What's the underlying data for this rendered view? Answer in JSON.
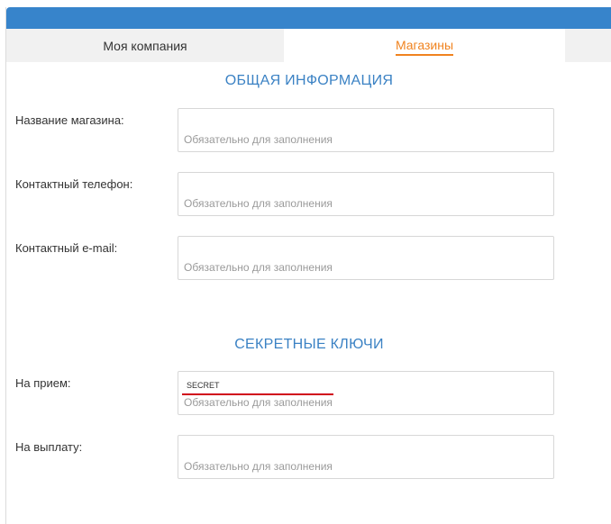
{
  "theme": {
    "header_color": "#3784cb",
    "accent": "#f0831f",
    "section_title_color": "#3b82c4",
    "error_color": "#d0021b"
  },
  "tabs": [
    {
      "label": "Моя компания",
      "active": false
    },
    {
      "label": "Магазины",
      "active": true
    }
  ],
  "sections": {
    "general": {
      "title": "ОБЩАЯ ИНФОРМАЦИЯ",
      "fields": [
        {
          "label": "Название магазина:",
          "value": "",
          "hint": "Обязательно для заполнения"
        },
        {
          "label": "Контактный телефон:",
          "value": "",
          "hint": "Обязательно для заполнения"
        },
        {
          "label": "Контактный e-mail:",
          "value": "",
          "hint": "Обязательно для заполнения"
        }
      ]
    },
    "secret_keys": {
      "title": "СЕКРЕТНЫЕ КЛЮЧИ",
      "fields": [
        {
          "label": "На прием:",
          "value": "SECRET",
          "hint": "Обязательно для заполнения"
        },
        {
          "label": "На выплату:",
          "value": "",
          "hint": "Обязательно для заполнения"
        }
      ]
    }
  }
}
